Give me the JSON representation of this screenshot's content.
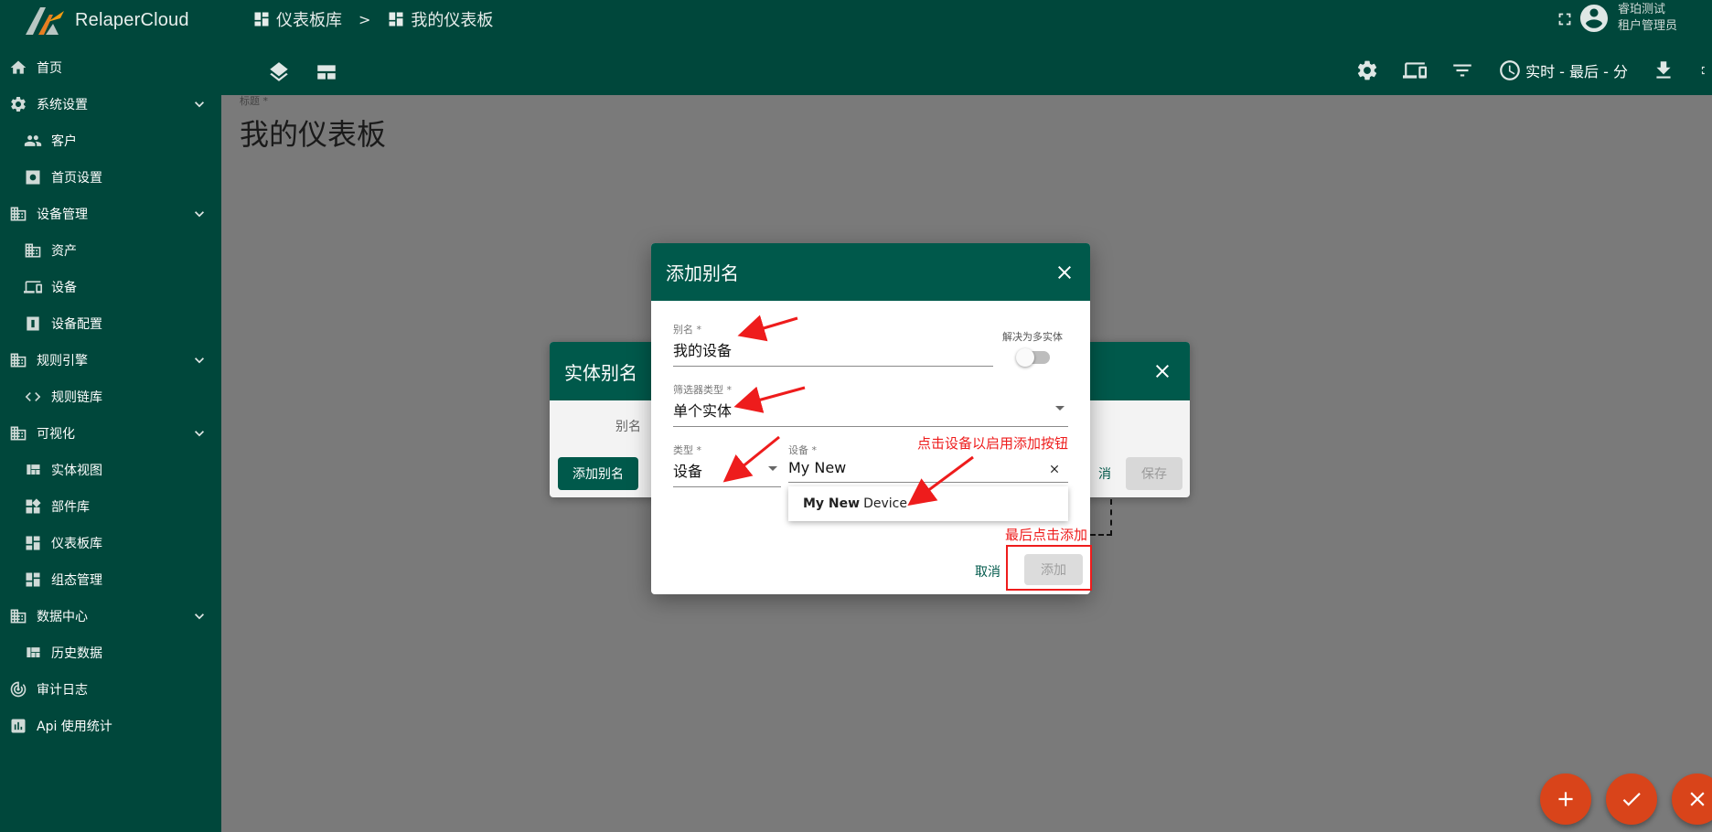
{
  "app": {
    "brand": "RelaperCloud"
  },
  "breadcrumb": {
    "item1": "仪表板库",
    "separator": ">",
    "item2": "我的仪表板"
  },
  "user": {
    "name": "睿珀测试",
    "role": "租户管理员"
  },
  "toolbar": {
    "time_window": "实时 - 最后 - 分"
  },
  "sidebar": {
    "items": [
      {
        "label": "首页",
        "icon": "home-icon",
        "level": "top",
        "expandable": false
      },
      {
        "label": "系统设置",
        "icon": "gear-icon",
        "level": "top",
        "expandable": true
      },
      {
        "label": "客户",
        "icon": "people-icon",
        "level": "sub",
        "expandable": false
      },
      {
        "label": "首页设置",
        "icon": "settings-box-icon",
        "level": "sub",
        "expandable": false
      },
      {
        "label": "设备管理",
        "icon": "building-icon",
        "level": "top",
        "expandable": true
      },
      {
        "label": "资产",
        "icon": "building-icon",
        "level": "sub",
        "expandable": false
      },
      {
        "label": "设备",
        "icon": "devices-icon",
        "level": "sub",
        "expandable": false
      },
      {
        "label": "设备配置",
        "icon": "device-profile-icon",
        "level": "sub",
        "expandable": false
      },
      {
        "label": "规则引擎",
        "icon": "building-icon",
        "level": "top",
        "expandable": true
      },
      {
        "label": "规则链库",
        "icon": "code-icon",
        "level": "sub",
        "expandable": false
      },
      {
        "label": "可视化",
        "icon": "building-icon",
        "level": "top",
        "expandable": true
      },
      {
        "label": "实体视图",
        "icon": "view-quilt-icon",
        "level": "sub",
        "expandable": false
      },
      {
        "label": "部件库",
        "icon": "widgets-icon",
        "level": "sub",
        "expandable": false
      },
      {
        "label": "仪表板库",
        "icon": "dashboard-icon",
        "level": "sub",
        "expandable": false
      },
      {
        "label": "组态管理",
        "icon": "dashboard-icon",
        "level": "sub",
        "expandable": false
      },
      {
        "label": "数据中心",
        "icon": "building-icon",
        "level": "top",
        "expandable": true
      },
      {
        "label": "历史数据",
        "icon": "view-quilt-icon",
        "level": "sub",
        "expandable": false
      },
      {
        "label": "审计日志",
        "icon": "track-changes-icon",
        "level": "top",
        "expandable": false
      },
      {
        "label": "Api 使用统计",
        "icon": "bar-chart-icon",
        "level": "top",
        "expandable": false
      }
    ]
  },
  "main": {
    "title_label": "标题 *",
    "title": "我的仪表板"
  },
  "entity_alias_dialog": {
    "title": "实体别名",
    "column_alias": "别名",
    "add_alias_button": "添加别名",
    "cancel_button": "取消",
    "save_button": "保存"
  },
  "add_alias_dialog": {
    "title": "添加别名",
    "alias_label": "别名 *",
    "alias_value": "我的设备",
    "resolve_multiple_label": "解决为多实体",
    "resolve_multiple_on": false,
    "filter_type_label": "筛选器类型 *",
    "filter_type_value": "单个实体",
    "type_label": "类型 *",
    "type_value": "设备",
    "device_label": "设备 *",
    "device_value": "My New",
    "suggestion_match": "My New",
    "suggestion_rest": "Device",
    "cancel_button": "取消",
    "add_button": "添加"
  },
  "annotations": {
    "click_device": "点击设备以启用添加按钮",
    "click_add": "最后点击添加"
  },
  "colors": {
    "primary": "#00473b",
    "dialog_header": "#00594b",
    "fab": "#d9441a",
    "annotation": "#ee1c1c"
  }
}
